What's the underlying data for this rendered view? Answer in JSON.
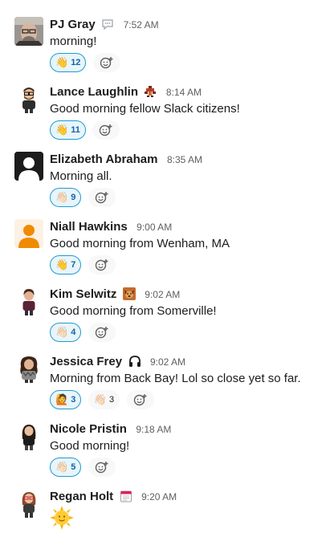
{
  "messages": [
    {
      "name": "PJ Gray",
      "status_icon": "speech-bubble-icon",
      "time": "7:52 AM",
      "text": "morning!",
      "avatar": "photo",
      "reactions": [
        {
          "emoji": "👋",
          "count": "12",
          "reacted": true
        }
      ]
    },
    {
      "name": "Lance Laughlin",
      "status_icon": "pixel-sprite-icon",
      "time": "8:14 AM",
      "text": "Good morning fellow Slack citizens!",
      "avatar": "cartoon-glasses",
      "reactions": [
        {
          "emoji": "👋",
          "count": "11",
          "reacted": true
        }
      ]
    },
    {
      "name": "Elizabeth Abraham",
      "status_icon": "",
      "time": "8:35 AM",
      "text": "Morning all.",
      "avatar": "default-black",
      "reactions": [
        {
          "emoji": "👋🏻",
          "count": "9",
          "reacted": true
        }
      ]
    },
    {
      "name": "Niall Hawkins",
      "status_icon": "",
      "time": "9:00 AM",
      "text": "Good morning from Wenham, MA",
      "avatar": "default-orange",
      "reactions": [
        {
          "emoji": "👋",
          "count": "7",
          "reacted": true
        }
      ]
    },
    {
      "name": "Kim Selwitz",
      "status_icon": "dog-icon",
      "time": "9:02 AM",
      "text": "Good morning from Somerville!",
      "avatar": "cartoon-woman",
      "reactions": [
        {
          "emoji": "👋🏻",
          "count": "4",
          "reacted": true
        }
      ]
    },
    {
      "name": "Jessica Frey",
      "status_icon": "headphones-icon",
      "time": "9:02 AM",
      "text": "Morning from Back Bay! Lol so close yet so far.",
      "avatar": "cartoon-curly",
      "reactions": [
        {
          "emoji": "🙋",
          "count": "3",
          "reacted": true
        },
        {
          "emoji": "👋🏻",
          "count": "3",
          "reacted": false
        }
      ]
    },
    {
      "name": "Nicole Pristin",
      "status_icon": "",
      "time": "9:18 AM",
      "text": "Good morning!",
      "avatar": "cartoon-longhair",
      "reactions": [
        {
          "emoji": "👋🏻",
          "count": "5",
          "reacted": true
        }
      ]
    },
    {
      "name": "Regan Holt",
      "status_icon": "calendar-icon",
      "time": "9:20 AM",
      "text": "",
      "avatar": "cartoon-redglasses",
      "emoji_message": "sun-with-face",
      "reactions": []
    }
  ],
  "colors": {
    "reacted_bg": "#e8f5fa",
    "reacted_border": "#1d9bd1",
    "reacted_text": "#1264a3",
    "time": "#616061"
  }
}
